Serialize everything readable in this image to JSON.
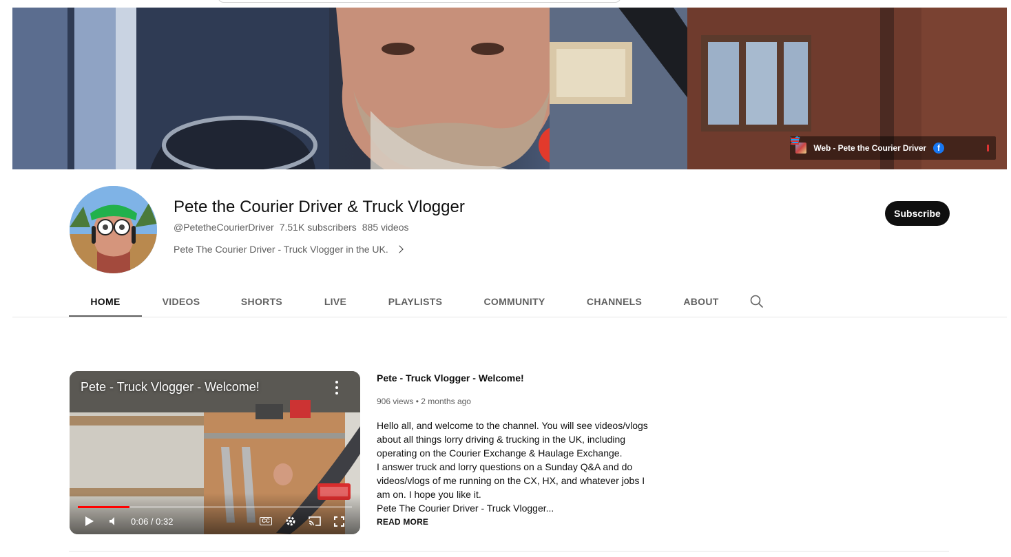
{
  "banner": {
    "links": {
      "web_label": "Web - Pete the Courier Driver",
      "icons": [
        "website-icon",
        "facebook-icon",
        "twitter-icon",
        "rss-icon",
        "link-icon"
      ]
    }
  },
  "channel": {
    "name": "Pete the Courier Driver & Truck Vlogger",
    "handle": "@PetetheCourierDriver",
    "subscribers": "7.51K subscribers",
    "videos": "885 videos",
    "description": "Pete The Courier Driver - Truck Vlogger in the UK.",
    "subscribe_label": "Subscribe"
  },
  "tabs": [
    {
      "label": "HOME",
      "active": true
    },
    {
      "label": "VIDEOS",
      "active": false
    },
    {
      "label": "SHORTS",
      "active": false
    },
    {
      "label": "LIVE",
      "active": false
    },
    {
      "label": "PLAYLISTS",
      "active": false
    },
    {
      "label": "COMMUNITY",
      "active": false
    },
    {
      "label": "CHANNELS",
      "active": false
    },
    {
      "label": "ABOUT",
      "active": false
    }
  ],
  "featured": {
    "player_title": "Pete - Truck Vlogger - Welcome!",
    "time": "0:06 / 0:32",
    "progress_fraction": 0.1875,
    "title": "Pete - Truck Vlogger - Welcome!",
    "views": "906 views",
    "age": "2 months ago",
    "description_lines": [
      "Hello all, and welcome to the channel.  You will see videos/vlogs",
      "about all things lorry driving & trucking in the UK, including",
      "operating on the Courier Exchange & Haulage Exchange.",
      "I answer truck and lorry questions on a Sunday Q&A and do",
      "videos/vlogs of me running on the CX, HX, and whatever jobs I",
      "am on. I hope you like it.",
      "Pete The Courier Driver - Truck Vlogger..."
    ],
    "read_more": "READ MORE"
  },
  "colors": {
    "accent_red": "#ff0000",
    "subscribe_bg": "#0f0f0f",
    "text_secondary": "#606060"
  }
}
